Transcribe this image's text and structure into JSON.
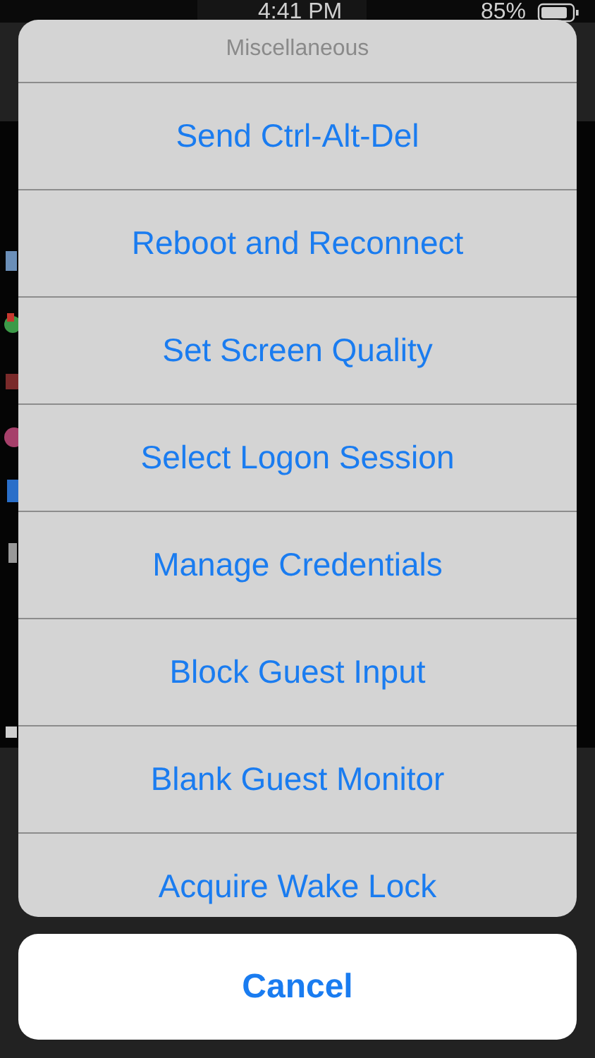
{
  "status_bar": {
    "time": "4:41 PM",
    "battery": "85%"
  },
  "action_sheet": {
    "title": "Miscellaneous",
    "actions": [
      "Send Ctrl-Alt-Del",
      "Reboot and Reconnect",
      "Set Screen Quality",
      "Select Logon Session",
      "Manage Credentials",
      "Block Guest Input",
      "Blank Guest Monitor",
      "Acquire Wake Lock"
    ],
    "cancel": "Cancel"
  }
}
